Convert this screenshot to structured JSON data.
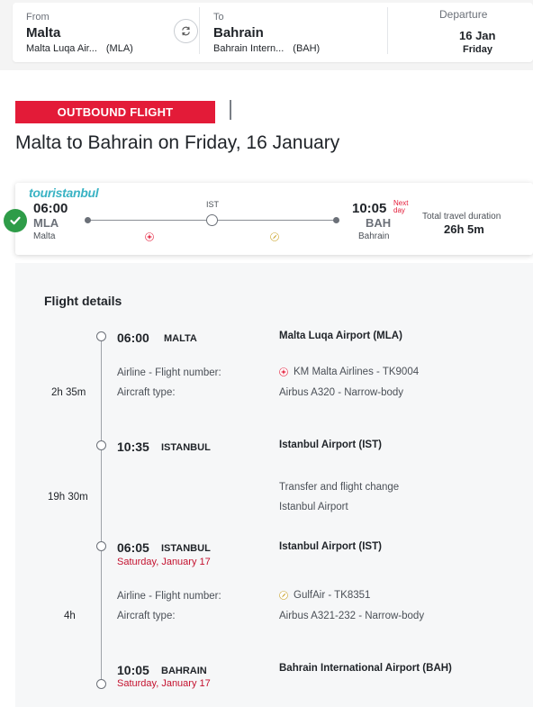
{
  "search": {
    "from_label": "From",
    "from_city": "Malta",
    "from_airport": "Malta Luqa Air...",
    "from_code": "(MLA)",
    "to_label": "To",
    "to_city": "Bahrain",
    "to_airport": "Bahrain Intern...",
    "to_code": "(BAH)",
    "departure_label": "Departure",
    "departure_date": "16 Jan",
    "departure_day": "Friday"
  },
  "header": {
    "badge": "OUTBOUND FLIGHT",
    "title": "Malta to Bahrain on Friday, 16 January"
  },
  "flight_card": {
    "logo_text": "touristanbul",
    "dep_time": "06:00",
    "dep_code": "MLA",
    "dep_city": "Malta",
    "stop_code": "IST",
    "arr_time": "10:05",
    "next_day": "Next day",
    "arr_code": "BAH",
    "arr_city": "Bahrain",
    "duration_label": "Total travel duration",
    "duration": "26h 5m"
  },
  "details": {
    "title": "Flight details",
    "stops": [
      {
        "time": "06:00",
        "city": "MALTA",
        "date": "",
        "airport": "Malta Luqa Airport (MLA)"
      },
      {
        "time": "10:35",
        "city": "ISTANBUL",
        "date": "",
        "airport": "Istanbul Airport (IST)"
      },
      {
        "time": "06:05",
        "city": "ISTANBUL",
        "date": "Saturday, January 17",
        "airport": "Istanbul Airport (IST)"
      },
      {
        "time": "10:05",
        "city": "BAHRAIN",
        "date": "Saturday, January 17",
        "airport": "Bahrain International Airport (BAH)"
      }
    ],
    "segments": [
      {
        "duration": "2h 35m",
        "airline_label": "Airline - Flight number:",
        "airline": "KM Malta Airlines - TK9004",
        "aircraft_label": "Aircraft type:",
        "aircraft": "Airbus A320 - Narrow-body"
      },
      {
        "duration": "4h",
        "airline_label": "Airline - Flight number:",
        "airline": "GulfAir - TK8351",
        "aircraft_label": "Aircraft type:",
        "aircraft": "Airbus A321-232 - Narrow-body"
      }
    ],
    "transfer": {
      "duration": "19h 30m",
      "title": "Transfer and flight change",
      "airport": "Istanbul Airport"
    }
  },
  "colors": {
    "accent_red": "#e31b38",
    "success_green": "#2e9c48",
    "date_red": "#c4122f"
  }
}
